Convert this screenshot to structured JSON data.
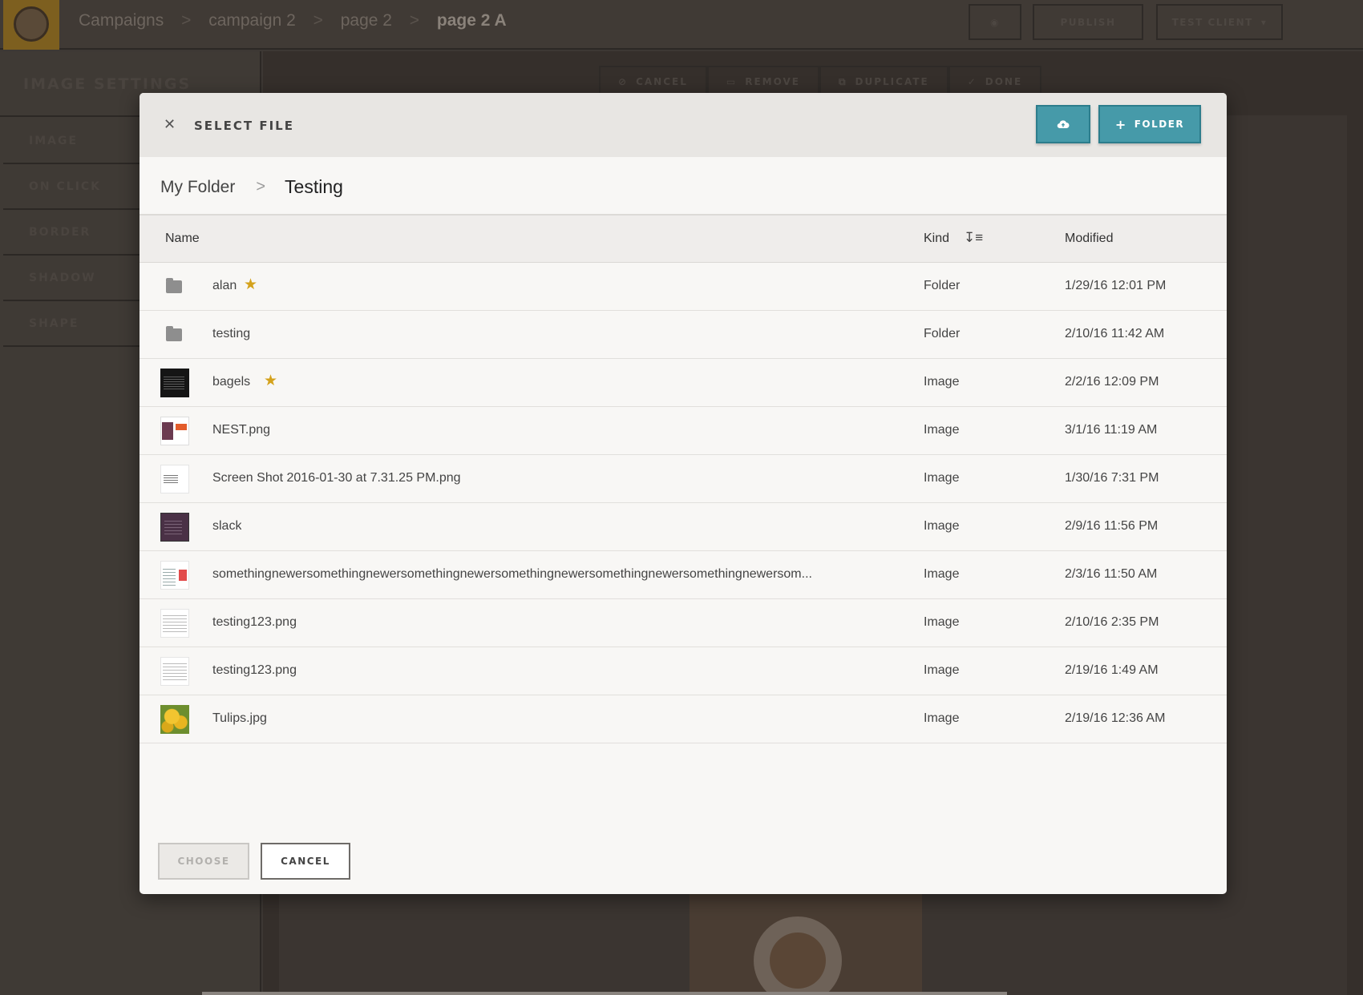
{
  "app": {
    "breadcrumb": [
      "Campaigns",
      "campaign 2",
      "page 2",
      "page 2 A"
    ],
    "breadcrumb_separator": ">",
    "topbar": {
      "publish_label": "PUBLISH",
      "client_label": "TEST CLIENT"
    },
    "sidebar": {
      "title": "IMAGE SETTINGS",
      "items": [
        "IMAGE",
        "ON CLICK",
        "BORDER",
        "SHADOW",
        "SHAPE"
      ]
    },
    "toolbar": {
      "cancel_label": "CANCEL",
      "remove_label": "REMOVE",
      "duplicate_label": "DUPLICATE",
      "done_label": "DONE"
    }
  },
  "modal": {
    "title": "SELECT FILE",
    "close_icon": "close-icon",
    "upload_icon": "cloud-upload-icon",
    "folder_button_label": "FOLDER",
    "breadcrumb": {
      "root": "My Folder",
      "separator": ">",
      "current": "Testing"
    },
    "columns": {
      "name": "Name",
      "kind": "Kind",
      "modified": "Modified"
    },
    "files": [
      {
        "name": "alan",
        "kind": "Folder",
        "modified": "1/29/16 12:01 PM",
        "starred": true,
        "icon": "folder-icon"
      },
      {
        "name": "testing",
        "kind": "Folder",
        "modified": "2/10/16 11:42 AM",
        "starred": false,
        "icon": "folder-icon"
      },
      {
        "name": "bagels",
        "kind": "Image",
        "modified": "2/2/16 12:09 PM",
        "starred": true,
        "icon": "bagels-thumbnail"
      },
      {
        "name": "NEST.png",
        "kind": "Image",
        "modified": "3/1/16 11:19 AM",
        "starred": false,
        "icon": "nest-thumbnail"
      },
      {
        "name": "Screen Shot 2016-01-30 at 7.31.25 PM.png",
        "kind": "Image",
        "modified": "1/30/16 7:31 PM",
        "starred": false,
        "icon": "screenshot-thumbnail"
      },
      {
        "name": "slack",
        "kind": "Image",
        "modified": "2/9/16 11:56 PM",
        "starred": false,
        "icon": "slack-thumbnail"
      },
      {
        "name": "somethingnewersomethingnewersomethingnewersomethingnewersomethingnewersomethingnewersom...",
        "kind": "Image",
        "modified": "2/3/16 11:50 AM",
        "starred": false,
        "icon": "document-thumbnail"
      },
      {
        "name": "testing123.png",
        "kind": "Image",
        "modified": "2/10/16 2:35 PM",
        "starred": false,
        "icon": "document-thumbnail"
      },
      {
        "name": "testing123.png",
        "kind": "Image",
        "modified": "2/19/16 1:49 AM",
        "starred": false,
        "icon": "document-thumbnail"
      },
      {
        "name": "Tulips.jpg",
        "kind": "Image",
        "modified": "2/19/16 12:36 AM",
        "starred": false,
        "icon": "tulips-thumbnail"
      }
    ],
    "choose_label": "CHOOSE",
    "cancel_label": "CANCEL",
    "colors": {
      "accent": "#469aa9",
      "star": "#d4a21c"
    }
  }
}
